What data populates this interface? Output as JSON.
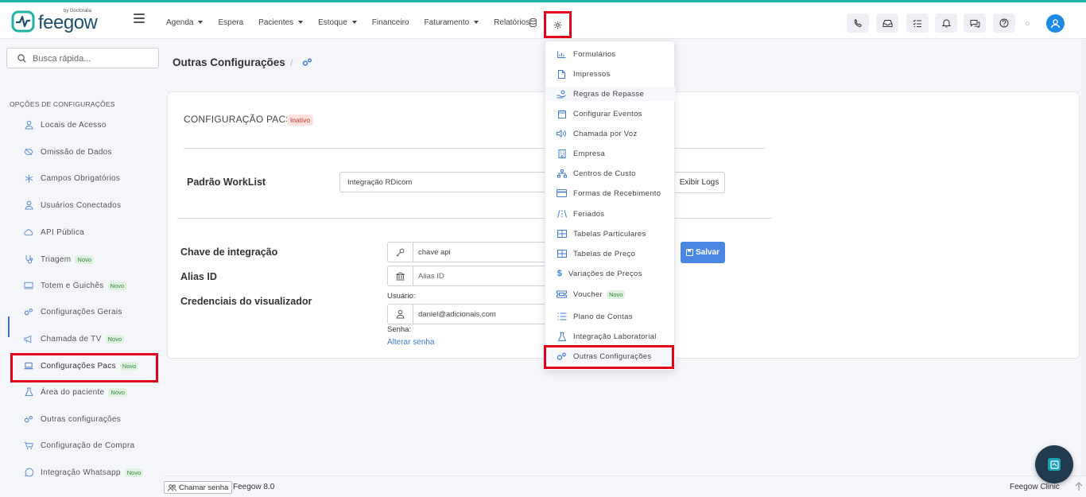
{
  "brand": {
    "name": "feegow",
    "by": "by Doctoralia"
  },
  "nav": {
    "items": [
      {
        "label": "Agenda",
        "caret": true
      },
      {
        "label": "Espera",
        "caret": false
      },
      {
        "label": "Pacientes",
        "caret": true
      },
      {
        "label": "Estoque",
        "caret": true
      },
      {
        "label": "Financeiro",
        "caret": false
      },
      {
        "label": "Faturamento",
        "caret": true
      },
      {
        "label": "Relatórios",
        "caret": false
      }
    ]
  },
  "top_icons": [
    "phone-icon",
    "inbox-icon",
    "tasks-icon",
    "bell-icon",
    "chat-icon",
    "help-icon"
  ],
  "search": {
    "placeholder": "Busca rápida..."
  },
  "sidebar": {
    "title": "OPÇÕES DE CONFIGURAÇÕES",
    "items": [
      {
        "label": "Locais de Acesso",
        "icon": "user-pin-icon",
        "novo": false
      },
      {
        "label": "Omissão de Dados",
        "icon": "eye-off-icon",
        "novo": false
      },
      {
        "label": "Campos Obrigatórios",
        "icon": "asterisk-icon",
        "novo": false
      },
      {
        "label": "Usuários Conectados",
        "icon": "user-icon",
        "novo": false
      },
      {
        "label": "API Pública",
        "icon": "cloud-icon",
        "novo": false
      },
      {
        "label": "Triagem",
        "icon": "stethoscope-icon",
        "novo": true
      },
      {
        "label": "Totem e Guichês",
        "icon": "monitor-icon",
        "novo": true
      },
      {
        "label": "Configurações Gerais",
        "icon": "gears-icon",
        "novo": false
      },
      {
        "label": "Chamada de TV",
        "icon": "megaphone-icon",
        "novo": true
      },
      {
        "label": "Configurações Pacs",
        "icon": "laptop-icon",
        "novo": true,
        "active": true
      },
      {
        "label": "Área do paciente",
        "icon": "flask-icon",
        "novo": true
      },
      {
        "label": "Outras configurações",
        "icon": "gears-icon",
        "novo": false
      },
      {
        "label": "Configuração de Compra",
        "icon": "cart-icon",
        "novo": false
      },
      {
        "label": "Integração Whatsapp",
        "icon": "whatsapp-icon",
        "novo": true
      }
    ],
    "novo_label": "Novo"
  },
  "page": {
    "title": "Outras Configurações",
    "crumb_sep": "/"
  },
  "card": {
    "title": "CONFIGURAÇÃO PACS",
    "status": "Inativo",
    "worklist_label": "Padrão WorkList",
    "worklist_value": "Integração RDicom",
    "logs_button": "Exibir Logs",
    "chave_label": "Chave de integração",
    "chave_value": "chave api",
    "alias_label": "Alias ID",
    "alias_value": "Alias ID",
    "cred_label": "Credenciais do visualizador",
    "usuario_label": "Usuário:",
    "usuario_value": "daniel@adicionais.com",
    "senha_label": "Senha:",
    "alterar_senha": "Alterar senha",
    "salvar": "Salvar"
  },
  "dropdown": {
    "items": [
      {
        "label": "Formulários",
        "icon": "chart-icon"
      },
      {
        "label": "Impressos",
        "icon": "file-icon"
      },
      {
        "label": "Regras de Repasse",
        "icon": "hand-coin-icon"
      },
      {
        "label": "Configurar Eventos",
        "icon": "calendar-icon"
      },
      {
        "label": "Chamada por Voz",
        "icon": "speaker-icon"
      },
      {
        "label": "Empresa",
        "icon": "building-icon"
      },
      {
        "label": "Centros de Custo",
        "icon": "sitemap-icon"
      },
      {
        "label": "Formas de Recebimento",
        "icon": "credit-card-icon"
      },
      {
        "label": "Feriados",
        "icon": "road-icon"
      },
      {
        "label": "Tabelas Particulares",
        "icon": "table-icon"
      },
      {
        "label": "Tabelas de Preço",
        "icon": "table-icon"
      },
      {
        "label": "Variações de Preços",
        "icon": "dollar-icon"
      },
      {
        "label": "Voucher",
        "icon": "ticket-icon",
        "novo": true
      },
      {
        "label": "Plano de Contas",
        "icon": "list-icon"
      },
      {
        "label": "Integração Laboratorial",
        "icon": "flask-icon"
      },
      {
        "label": "Outras Configurações",
        "icon": "gears-icon"
      }
    ]
  },
  "footer": {
    "chamar_senha": "Chamar senha",
    "version": "Feegow 8.0",
    "clinic": "Feegow Clinic"
  },
  "colors": {
    "accent": "#1fb2a6",
    "primary": "#4b87e2",
    "highlight": "#e3001b",
    "brand": "#1c4f6e"
  }
}
